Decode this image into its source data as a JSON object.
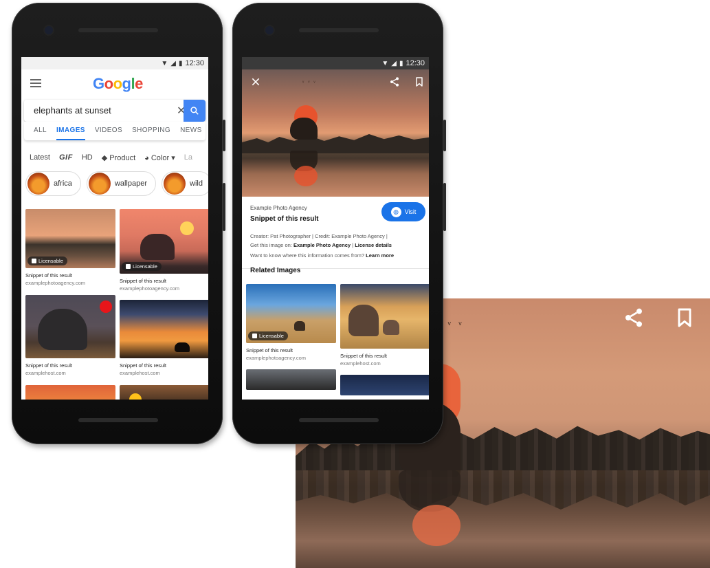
{
  "colors": {
    "accent": "#4285f4",
    "visit": "#1a73e8",
    "tabActive": "#1a73e8"
  },
  "status": {
    "time": "12:30",
    "icons": [
      "wifi-icon",
      "signal-icon",
      "battery-icon"
    ]
  },
  "phone1": {
    "logo": [
      "G",
      "o",
      "o",
      "g",
      "l",
      "e"
    ],
    "search": {
      "value": "elephants at sunset"
    },
    "tabs": [
      "ALL",
      "IMAGES",
      "VIDEOS",
      "SHOPPING",
      "NEWS"
    ],
    "filters": {
      "latest": "Latest",
      "gif": "GIF",
      "hd": "HD",
      "product": "Product",
      "color": "Color",
      "more": "La"
    },
    "chips": [
      "africa",
      "wallpaper",
      "wild"
    ],
    "results": [
      {
        "caption": "Snippet of this result",
        "source": "examplephotoagency.com",
        "badge": "Licensable"
      },
      {
        "caption": "Snippet of this result",
        "source": "examplephotoagency.com",
        "badge": "Licensable"
      },
      {
        "caption": "Snippet of this result",
        "source": "examplehost.com"
      },
      {
        "caption": "Snippet of this result",
        "source": "examplehost.com"
      }
    ]
  },
  "phone2": {
    "agency": "Example Photo Agency",
    "title": "Snippet of this result",
    "visit": "Visit",
    "creator_line": "Creator: Pat Photographer | Credit: Example Photo Agency |",
    "get_image_prefix": "Get this image on:",
    "get_image_agency": "Example Photo Agency",
    "get_image_sep": "|",
    "license_details": "License details",
    "know_more_prefix": "Want to know where this information comes from?",
    "learn_more": "Learn more",
    "related_title": "Related Images",
    "related": [
      {
        "caption": "Snippet of this result",
        "source": "examplephotoagency.com",
        "badge": "Licensable"
      },
      {
        "caption": "Snippet of this result",
        "source": "examplehost.com"
      }
    ]
  }
}
